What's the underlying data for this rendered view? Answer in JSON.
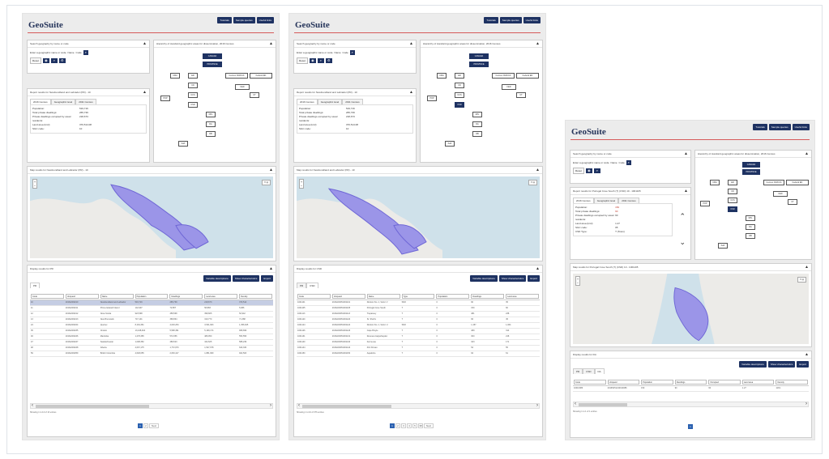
{
  "app": {
    "logo": "GeoSuite",
    "top_buttons": [
      "Tutorials",
      "Sample queries",
      "Useful links"
    ]
  },
  "screens": [
    {
      "search_panel_title": "Search geography by name or code",
      "hierarchy_title": "Hierarchy of standard geographic areas for dissemination, 2016 Census",
      "report_title": "Report results for Newfoundland and Labrador (PR) - 10",
      "report_tabs": [
        "2016 Census",
        "Geographic level",
        "2011 Census"
      ],
      "report_rows": [
        {
          "k": "Population:",
          "v": "519,716"
        },
        {
          "k": "Total private dwellings:",
          "v": "265,739"
        },
        {
          "k": "Private dwellings occupied by usual residents:",
          "v": "218,673"
        },
        {
          "k": "Land area (km²):",
          "v": "370,514.08"
        },
        {
          "k": "SGC code:",
          "v": "10"
        }
      ],
      "map_title": "Map results for Newfoundland and Labrador (PR) - 10",
      "display_title": "Display results for PR",
      "table_tabs": [
        "PR"
      ],
      "columns": [
        "Code",
        "Uniqueid",
        "Name",
        "Population",
        "Dwellings",
        "Land area",
        "Density"
      ],
      "rows": [
        [
          "10",
          "2016A000210",
          "Newfoundland and Labrador",
          "519,716",
          "265,739",
          "218,673",
          "370,514"
        ],
        [
          "11",
          "2016A000211",
          "Prince Edward Island",
          "142,907",
          "72,587",
          "58,883",
          "5,686"
        ],
        [
          "12",
          "2016A000212",
          "Nova Scotia",
          "923,598",
          "458,568",
          "398,605",
          "52,942"
        ],
        [
          "13",
          "2016A000213",
          "New Brunswick",
          "747,101",
          "368,864",
          "319,770",
          "71,388"
        ],
        [
          "24",
          "2016A000224",
          "Quebec",
          "8,164,361",
          "4,003,254",
          "3,531,663",
          "1,356,625"
        ],
        [
          "35",
          "2016A000235",
          "Ontario",
          "13,448,494",
          "5,598,391",
          "5,169,174",
          "908,699"
        ],
        [
          "46",
          "2016A000246",
          "Manitoba",
          "1,278,365",
          "572,056",
          "489,050",
          "553,556"
        ],
        [
          "47",
          "2016A000247",
          "Saskatchewan",
          "1,098,352",
          "489,523",
          "432,625",
          "588,239"
        ],
        [
          "48",
          "2016A000248",
          "Alberta",
          "4,067,175",
          "1,772,670",
          "1,527,678",
          "640,330"
        ],
        [
          "59",
          "2016A000259",
          "British Columbia",
          "4,648,055",
          "2,063,417",
          "1,881,969",
          "922,503"
        ]
      ],
      "showing": "Showing 1 to 13 of 13 entries",
      "pages": [
        "1",
        "2",
        "Next"
      ]
    },
    {
      "search_panel_title": "Search geography by name or code",
      "hierarchy_title": "Hierarchy of standard geographic areas for dissemination, 2016 Census",
      "report_title": "Report results for Newfoundland and Labrador (PR) - 10",
      "report_tabs": [
        "2016 Census",
        "Geographic level",
        "2011 Census"
      ],
      "report_rows": [
        {
          "k": "Population:",
          "v": "519,716"
        },
        {
          "k": "Total private dwellings:",
          "v": "265,739"
        },
        {
          "k": "Private dwellings occupied by usual residents:",
          "v": "218,673"
        },
        {
          "k": "Land area (km²):",
          "v": "370,514.08"
        },
        {
          "k": "SGC code:",
          "v": "10"
        }
      ],
      "map_title": "Map results for Newfoundland and Labrador (PR) - 10",
      "display_title": "Display results for CSD",
      "table_tabs": [
        "PR",
        "CSD"
      ],
      "columns": [
        "Code",
        "Uniqueid",
        "Name",
        "Type",
        "Population",
        "Dwellings",
        "Land area"
      ],
      "rows": [
        [
          "1001101",
          "2016A00051001101",
          "Division No. 1, Subd. V",
          "SNO",
          "0",
          "90",
          "35"
        ],
        [
          "1001105",
          "2016A00051001105",
          "Portugal Cove South",
          "T",
          "0",
          "150",
          "60"
        ],
        [
          "1001113",
          "2016A00051001113",
          "Trepassey",
          "T",
          "0",
          "481",
          "238"
        ],
        [
          "1001120",
          "2016A00051001120",
          "St. Shott's",
          "T",
          "0",
          "66",
          "45"
        ],
        [
          "1001124",
          "2016A00051001124",
          "Division No. 1, Subd. U",
          "SNO",
          "0",
          "1,157",
          "1,064"
        ],
        [
          "1001126",
          "2016A00051001126",
          "Cape Broyle",
          "T",
          "0",
          "489",
          "314"
        ],
        [
          "1001131",
          "2016A00051001131",
          "Renews-Cappahayden",
          "T",
          "0",
          "300",
          "218"
        ],
        [
          "1001140",
          "2016A00051001140",
          "Fermeuse",
          "T",
          "0",
          "323",
          "171"
        ],
        [
          "1001144",
          "2016A00051001144",
          "Port Kirwan",
          "T",
          "0",
          "54",
          "55"
        ],
        [
          "1001150",
          "2016A00051001150",
          "Aquaforte",
          "T",
          "0",
          "94",
          "61"
        ]
      ],
      "showing": "Showing 1 to 10 of 376 entries",
      "pages": [
        "1",
        "2",
        "3",
        "4",
        "5",
        "38",
        "Next"
      ]
    },
    {
      "search_panel_title": "Search geography by name or code",
      "hierarchy_title": "Hierarchy of standard geographic areas for dissemination, 2016 Census",
      "report_title": "Report results for Portugal Cove South (T) (CSD) 10 - 1001105",
      "report_tabs": [
        "2016 Census",
        "Geographic level",
        "2011 Census"
      ],
      "report_rows": [
        {
          "k": "Population:",
          "v": "150"
        },
        {
          "k": "Total private dwellings:",
          "v": "90"
        },
        {
          "k": "Private dwellings occupied by usual residents:",
          "v": "60"
        },
        {
          "k": "Land area (km²):",
          "v": "1.27"
        },
        {
          "k": "SGC code:",
          "v": "05"
        },
        {
          "k": "CSD Type:",
          "v": "T (Town)"
        }
      ],
      "map_title": "Map results for Portugal Cove South (T) (CSD) 10 - 1001105",
      "display_title": "Display results for DA",
      "table_tabs": [
        "PR",
        "CSD",
        "DA"
      ],
      "columns": [
        "Code",
        "Uniqueid",
        "Population",
        "Dwellings",
        "Occupied",
        "Land area",
        "Density"
      ],
      "rows": [
        [
          "10010086",
          "2016S051210010086",
          "150",
          "90",
          "60",
          "1.27",
          "118.1"
        ]
      ],
      "showing": "Showing 1 to 1 of 1 entries",
      "pages": [
        "1"
      ]
    }
  ],
  "search": {
    "label": "Enter a geographic name or code",
    "options": [
      "Name",
      "Code",
      "Both"
    ],
    "reset_label": "Reset"
  },
  "hierarchy_nodes": [
    "CANADA",
    "PROVINCE",
    "CMA",
    "ER",
    "CD",
    "POP",
    "CCS",
    "CSD",
    "DPL",
    "FED",
    "DA",
    "DB",
    "CT",
    "Census CMA/CA",
    "Federal ED",
    "AdA"
  ],
  "table_buttons": [
    "Variable descriptions",
    "Show characteristics",
    "Export"
  ],
  "colors": {
    "navy": "#1e3262",
    "accent": "#d65a5a",
    "selected_row": "#c5cde3",
    "map_water": "#cfe1ea",
    "map_region": "#9b95e8"
  }
}
